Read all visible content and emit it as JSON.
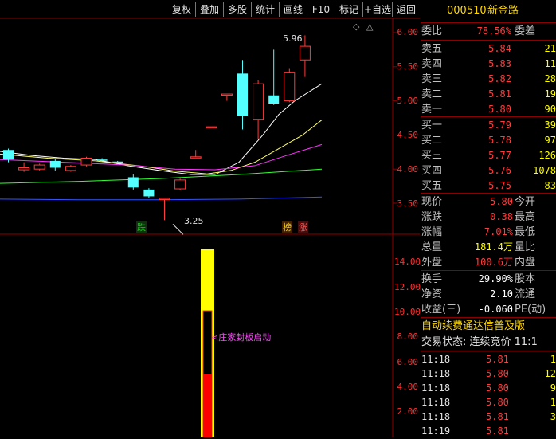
{
  "toolbar": {
    "items": [
      "复权",
      "叠加",
      "多股",
      "统计",
      "画线",
      "F10",
      "标记",
      "+自选",
      "返回"
    ]
  },
  "chart": {
    "price_axis": [
      "6.00",
      "5.50",
      "5.00",
      "4.50",
      "4.00",
      "3.50"
    ],
    "vol_axis": [
      "14.00",
      "12.00",
      "10.00",
      "8.00",
      "6.00",
      "4.00",
      "2.00"
    ],
    "high_label": "5.96",
    "low_label": "3.25",
    "tag_die": "跌",
    "tag_bang": "榜",
    "tag_zhang": "涨",
    "indicator_text": "庄家封板启动",
    "indicator_level": 0.5
  },
  "chart_data": {
    "type": "candlestick",
    "ylim": [
      3.25,
      6.1
    ],
    "candles": [
      {
        "o": 4.14,
        "c": 4.28,
        "h": 4.3,
        "l": 4.1,
        "up": false
      },
      {
        "o": 3.99,
        "c": 4.02,
        "h": 4.1,
        "l": 3.96,
        "up": true
      },
      {
        "o": 4.0,
        "c": 4.06,
        "h": 4.08,
        "l": 3.98,
        "up": true
      },
      {
        "o": 4.12,
        "c": 4.02,
        "h": 4.16,
        "l": 3.98,
        "up": false
      },
      {
        "o": 3.98,
        "c": 4.04,
        "h": 4.06,
        "l": 3.96,
        "up": true
      },
      {
        "o": 4.06,
        "c": 4.16,
        "h": 4.18,
        "l": 4.04,
        "up": true
      },
      {
        "o": 4.14,
        "c": 4.14,
        "h": 4.16,
        "l": 4.12,
        "up": false
      },
      {
        "o": 4.11,
        "c": 4.1,
        "h": 4.12,
        "l": 4.08,
        "up": false
      },
      {
        "o": 3.88,
        "c": 3.73,
        "h": 3.92,
        "l": 3.7,
        "up": false
      },
      {
        "o": 3.7,
        "c": 3.6,
        "h": 3.72,
        "l": 3.58,
        "up": false
      },
      {
        "o": 3.56,
        "c": 3.57,
        "h": 3.57,
        "l": 3.25,
        "up": true
      },
      {
        "o": 3.71,
        "c": 3.84,
        "h": 3.86,
        "l": 3.69,
        "up": true
      },
      {
        "o": 4.18,
        "c": 4.18,
        "h": 4.28,
        "l": 4.16,
        "up": true
      },
      {
        "o": 4.62,
        "c": 4.62,
        "h": 4.62,
        "l": 4.62,
        "up": true
      },
      {
        "o": 5.1,
        "c": 5.1,
        "h": 5.1,
        "l": 5.0,
        "up": true
      },
      {
        "o": 5.4,
        "c": 4.78,
        "h": 5.6,
        "l": 4.58,
        "up": false
      },
      {
        "o": 4.73,
        "c": 5.25,
        "h": 5.3,
        "l": 4.44,
        "up": true
      },
      {
        "o": 5.08,
        "c": 4.96,
        "h": 5.75,
        "l": 4.94,
        "up": false
      },
      {
        "o": 5.0,
        "c": 5.42,
        "h": 5.48,
        "l": 4.98,
        "up": true
      },
      {
        "o": 5.6,
        "c": 5.8,
        "h": 5.96,
        "l": 5.35,
        "up": true
      }
    ]
  },
  "quote": {
    "code": "000510",
    "name": "新金路",
    "weibi_label": "委比",
    "weibi_value": "78.56%",
    "weicha_label": "委差",
    "sell": [
      {
        "label": "卖五",
        "price": "5.84",
        "vol": "21"
      },
      {
        "label": "卖四",
        "price": "5.83",
        "vol": "11"
      },
      {
        "label": "卖三",
        "price": "5.82",
        "vol": "28"
      },
      {
        "label": "卖二",
        "price": "5.81",
        "vol": "19"
      },
      {
        "label": "卖一",
        "price": "5.80",
        "vol": "90"
      }
    ],
    "buy": [
      {
        "label": "买一",
        "price": "5.79",
        "vol": "39"
      },
      {
        "label": "买二",
        "price": "5.78",
        "vol": "97"
      },
      {
        "label": "买三",
        "price": "5.77",
        "vol": "126"
      },
      {
        "label": "买四",
        "price": "5.76",
        "vol": "1078"
      },
      {
        "label": "买五",
        "price": "5.75",
        "vol": "83"
      }
    ],
    "stats": [
      {
        "label": "现价",
        "value": "5.80",
        "label2": "今开"
      },
      {
        "label": "涨跌",
        "value": "0.38",
        "label2": "最高"
      },
      {
        "label": "涨幅",
        "value": "7.01%",
        "label2": "最低"
      },
      {
        "label": "总量",
        "value": "181.4万",
        "label2": "量比"
      },
      {
        "label": "外盘",
        "value": "100.6万",
        "label2": "内盘"
      }
    ],
    "stats2": [
      {
        "label": "换手",
        "value": "29.90%",
        "label2": "股本"
      },
      {
        "label": "净资",
        "value": "2.10",
        "label2": "流通"
      },
      {
        "label": "收益(三)",
        "value": "-0.060",
        "label2": "PE(动)"
      }
    ],
    "promo": "自动续费通达信普及版",
    "trade_status": "交易状态: 连续竞价 11:1",
    "ticks": [
      {
        "time": "11:18",
        "price": "5.81",
        "vol": "1"
      },
      {
        "time": "11:18",
        "price": "5.80",
        "vol": "12"
      },
      {
        "time": "11:18",
        "price": "5.80",
        "vol": "9"
      },
      {
        "time": "11:18",
        "price": "5.80",
        "vol": "1"
      },
      {
        "time": "11:18",
        "price": "5.81",
        "vol": "3"
      },
      {
        "time": "11:19",
        "price": "5.81",
        "vol": ""
      }
    ]
  }
}
